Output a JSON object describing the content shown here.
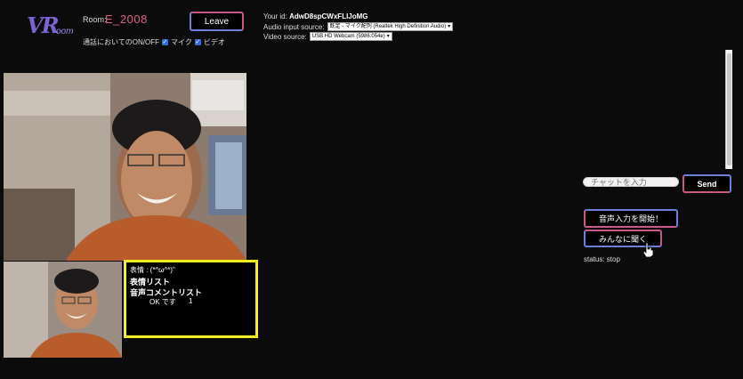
{
  "header": {
    "logo_big": "VR",
    "logo_small": "oom",
    "room_label": "Room:",
    "room_id": "E_2008",
    "leave_label": "Leave",
    "toggle_label": "通話においてのON/OFF",
    "mic_label": "マイク",
    "video_label": "ビデオ"
  },
  "connection": {
    "your_id_label": "Your id:",
    "your_id_value": "AdwD8spCWxFLlJoMG",
    "audio_label": "Audio input source:",
    "audio_value": "既定 - マイク配列 (Realtek High Definition Audio)",
    "video_label": "Video source:",
    "video_value": "USB HD Webcam (5986:054e)"
  },
  "info_box": {
    "expression_line": "表情 : (*^ω^*)\"",
    "expression_list_title": "表情リスト",
    "voice_list_title": "音声コメントリスト",
    "voice_entries": [
      {
        "text": "OK です",
        "count": "1"
      }
    ]
  },
  "chat": {
    "placeholder": "チャットを入力",
    "send_label": "Send"
  },
  "voice": {
    "start_label": "音声入力を開始！",
    "listen_label": "みんなに聞く",
    "status_text": "status: stop"
  },
  "colors": {
    "accent_pink": "#c85888",
    "accent_blue": "#6d7fd8",
    "room_id_color": "#e05f88",
    "info_border": "#f2ef22"
  }
}
